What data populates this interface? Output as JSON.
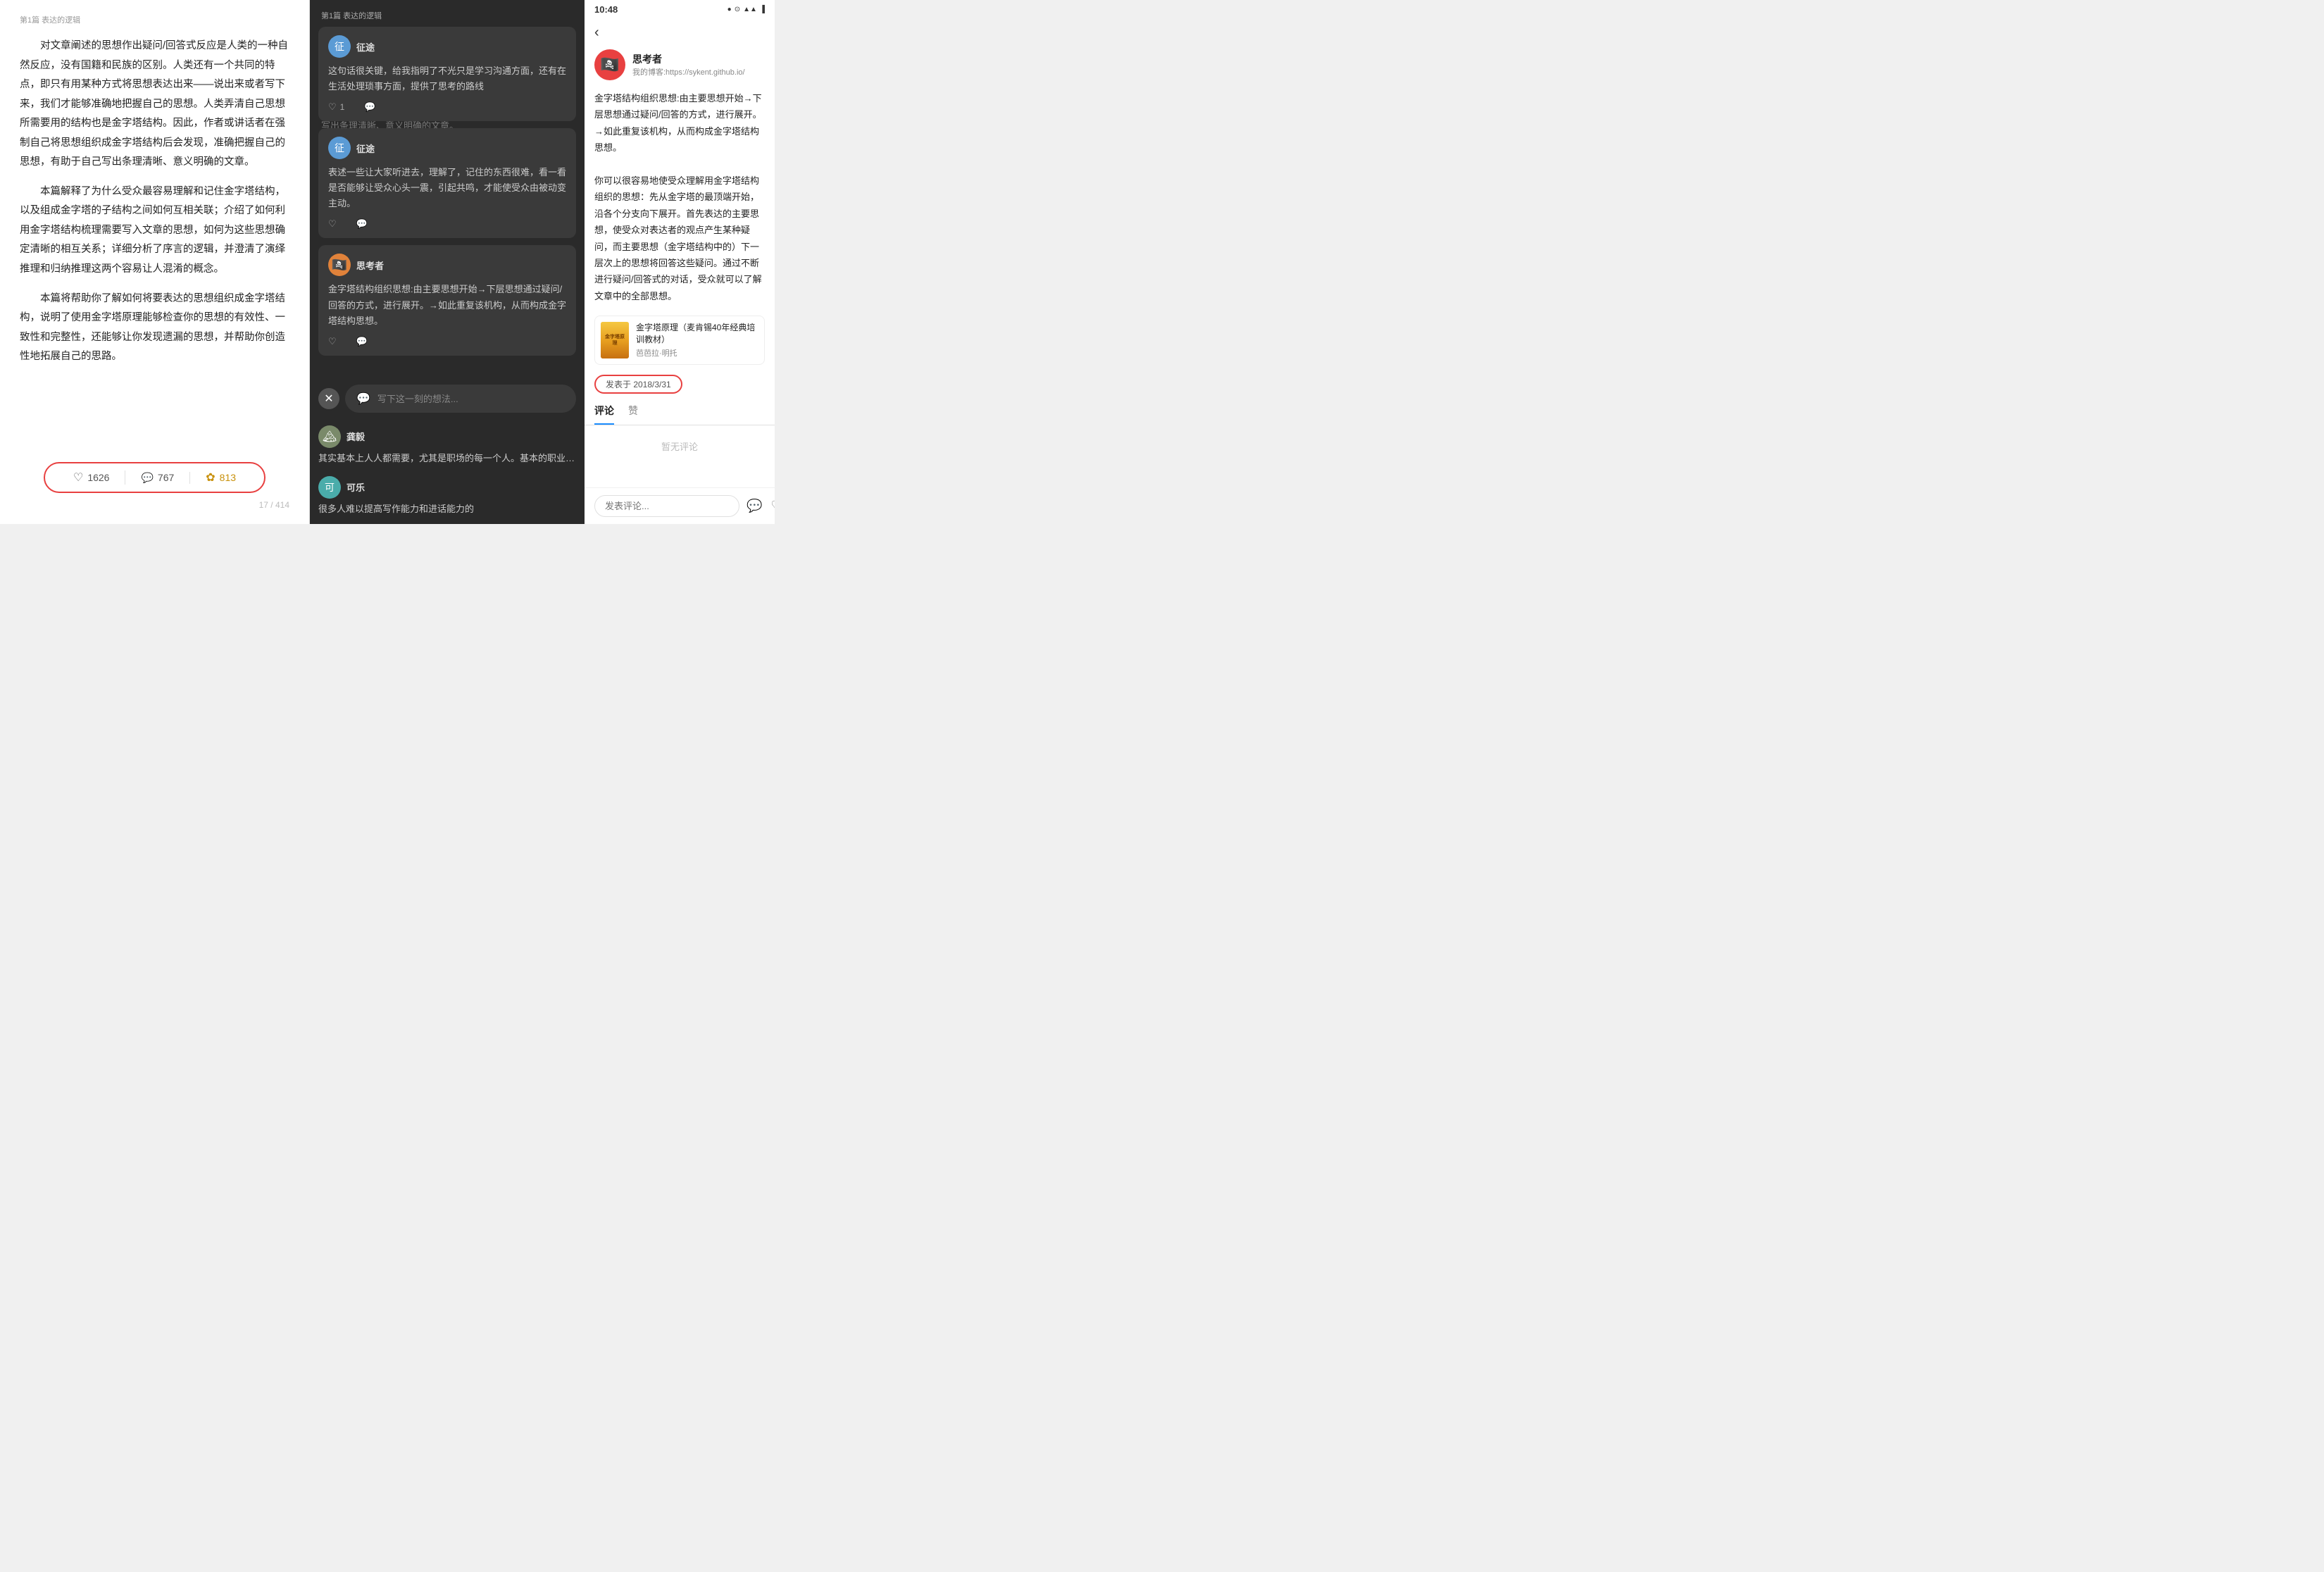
{
  "left": {
    "breadcrumb": "第1篇 表达的逻辑",
    "paragraphs": [
      "对文章阐述的思想作出疑问/回答式反应是人类的一种自然反应，没有国籍和民族的区别。人类还有一个共同的特点，即只有用某种方式将思想表达出来——说出来或者写下来，我们才能够准确地把握自己的思想。人类弄清自己思想所需要用的结构也是金字塔结构。因此，作者或讲话者在强制自己将思想组织成金字塔结构后会发现，准确把握自己的思想，有助于自己写出条理清晰、意义明确的文章。",
      "本篇解释了为什么受众最容易理解和记住金字塔结构，以及组成金字塔的子结构之间如何互相关联；介绍了如何利用金字塔结构梳理需要写入文章的思想，如何为这些思想确定清晰的相互关系；详细分析了序言的逻辑，并澄清了演绎推理和归纳推理这两个容易让人混淆的概念。",
      "本篇将帮助你了解如何将要表达的思想组织成金字塔结构，说明了使用金字塔原理能够检查你的思想的有效性、一致性和完整性，还能够让你发现遗漏的思想，并帮助你创造性地拓展自己的思路。"
    ],
    "stats": {
      "likes": "1626",
      "comments": "767",
      "shares": "813"
    },
    "page_indicator": "17 / 414"
  },
  "middle": {
    "breadcrumb": "第1篇 表达的逻辑",
    "bg_text": "对文章阐述的思想作出疑问/回答式反应是人类的一种自然反应，没有国籍和民族的区别。人类还有一个共同的特点，即只有用某种方式将思想表达出来——说出来或者写下来，我们才能够准确地把握自己的思想。人类弄清自己思想所需要用的结构也是金字塔结构。因此，作者或讲话者在强制自己将思想组织成金字塔结构后会发现，准确把握自己的思想，有助于自己写出条理清晰、意义明确的文章。",
    "comments": [
      {
        "id": "c1",
        "username": "征途",
        "avatar_type": "blue",
        "avatar_char": "征",
        "text": "这句话很关键，给我指明了不光只是学习沟通方面，还有在生活处理琐事方面，提供了思考的路线",
        "likes": "1",
        "has_like_count": true
      },
      {
        "id": "c2",
        "username": "征途",
        "avatar_type": "blue",
        "avatar_char": "征",
        "text": "表述一些让大家听进去，理解了，记住的东西很难，看一看是否能够让受众心头一震，引起共鸣，才能使受众由被动变主动。",
        "likes": "",
        "has_like_count": false
      },
      {
        "id": "c3",
        "username": "思考者",
        "avatar_type": "orange",
        "avatar_char": "🏴‍☠️",
        "text": "金字塔结构组织思想:由主要思想开始→下层思想通过疑问/回答的方式，进行展开。→如此重复该机构，从而构成金字塔结构思想。",
        "likes": "",
        "has_like_count": false
      }
    ],
    "partial_comment": {
      "username": "龚毅",
      "avatar_type": "scenic",
      "avatar_char": "🏔",
      "text": "其实基本上人人都需要，尤其是职场的每一个人。基本的职业化素养。"
    },
    "partial_comment2": {
      "username": "可乐",
      "avatar_type": "teal",
      "avatar_char": "可",
      "text": "很多人难以提高写作能力和进话能力的"
    },
    "input_placeholder": "写下这一刻的想法..."
  },
  "right": {
    "status_bar": {
      "time": "10:48",
      "icons": "● □ ⊙ ▲ ▲ ▐"
    },
    "author": {
      "name": "思考者",
      "blog": "我的博客:https://sykent.github.io/"
    },
    "article_text": "金字塔结构组织思想:由主要思想开始→下层思想通过疑问/回答的方式，进行展开。→如此重复该机构，从而构成金字塔结构思想。\n\n你可以很容易地使受众理解用金字塔结构组织的思想：先从金字塔的最顶端开始，沿各个分支向下展开。首先表达的主要思想，使受众对表达者的观点产生某种疑问，而主要思想（金字塔结构中的）下一层次上的思想将回答这些疑问。通过不断进行疑问/回答式的对话，受众就可以了解文章中的全部思想。",
    "book": {
      "title": "金字塔原理（麦肯锡40年经典培训教材）",
      "author": "芭芭拉·明托",
      "cover_text": "金字塔原理"
    },
    "publish_date": "发表于 2018/3/31",
    "tabs": [
      "评论",
      "赞"
    ],
    "active_tab": "评论",
    "no_comments": "暂无评论",
    "comment_input_placeholder": "发表评论...",
    "icons": {
      "comment": "💬",
      "heart": "♡",
      "share": "⎙"
    }
  }
}
